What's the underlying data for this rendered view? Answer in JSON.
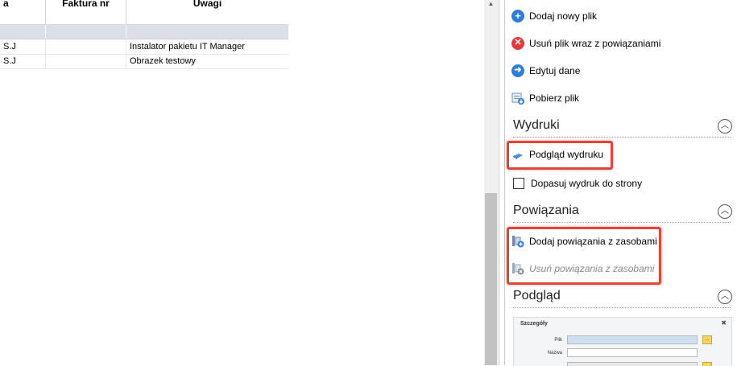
{
  "grid": {
    "columns": [
      {
        "key": "a",
        "label": "a"
      },
      {
        "key": "faktura",
        "label": "Faktura nr"
      },
      {
        "key": "uwagi",
        "label": "Uwagi"
      }
    ],
    "rows": [
      {
        "a": "S.J",
        "faktura": "",
        "uwagi": "Instalator pakietu IT Manager"
      },
      {
        "a": "S.J",
        "faktura": "",
        "uwagi": "Obrazek testowy"
      }
    ]
  },
  "panel": {
    "file_actions": [
      {
        "label": "Dodaj nowy plik",
        "icon": "add-circle-icon"
      },
      {
        "label": "Usuń plik wraz z powiązaniami",
        "icon": "remove-circle-icon"
      },
      {
        "label": "Edytuj dane",
        "icon": "arrow-right-circle-icon"
      },
      {
        "label": "Pobierz plik",
        "icon": "download-icon"
      }
    ],
    "wydruki": {
      "title": "Wydruki",
      "preview_label": "Podgląd wydruku",
      "fit_label": "Dopasuj wydruk do strony",
      "fit_checked": false
    },
    "powiazania": {
      "title": "Powiązania",
      "add_label": "Dodaj powiązania z zasobami",
      "remove_label": "Usuń powiązania z zasobami"
    },
    "podglad": {
      "title": "Podgląd",
      "thumb_title": "Szczegóły",
      "thumb_plik": "Plik",
      "thumb_nazwa": "Nazwa"
    }
  },
  "colors": {
    "highlight": "#e0453b",
    "add": "#2f7fd8",
    "remove": "#e23b3b",
    "edit": "#2f7fd8"
  }
}
